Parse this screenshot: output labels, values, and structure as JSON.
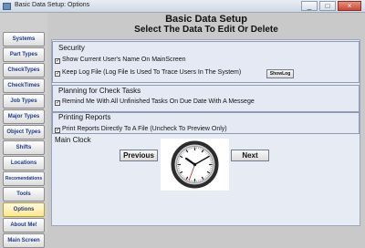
{
  "window": {
    "title": "Basic Data Setup: Options"
  },
  "header": {
    "title": "Basic Data Setup",
    "subtitle": "Select The Data To Edit Or Delete"
  },
  "sidebar": {
    "items": [
      {
        "label": "Systems"
      },
      {
        "label": "Part Types"
      },
      {
        "label": "CheckTypes"
      },
      {
        "label": "CheckTimes"
      },
      {
        "label": "Job Types"
      },
      {
        "label": "Major Types"
      },
      {
        "label": "Object Types"
      },
      {
        "label": "Shifts"
      },
      {
        "label": "Locations"
      },
      {
        "label": "Recomendations"
      },
      {
        "label": "Tools"
      },
      {
        "label": "Options"
      },
      {
        "label": "About Me!"
      },
      {
        "label": "Main Screen"
      }
    ]
  },
  "security": {
    "title": "Security",
    "show_user_label": "Show Current User's Name On MainScreen",
    "keep_log_label": "Keep Log File (Log File Is Used To Trace Users In The System)",
    "showlog_button": "ShowLog"
  },
  "planning": {
    "title": "Planning for Check Tasks",
    "remind_label": "Remind Me With All Unfinished Tasks On Due Date With A Messege"
  },
  "printing": {
    "title": "Printing Reports",
    "print_label": "Print Reports Directly To A File (Uncheck To Preview Only)"
  },
  "clock": {
    "title": "Main Clock",
    "previous_label": "Previous",
    "next_label": "Next",
    "time": {
      "hours": 10,
      "minutes": 10
    }
  },
  "colors": {
    "accent": "#1f3c88",
    "selected_sidebar": "#fff2b8",
    "panel_background": "#e7ebf4"
  }
}
